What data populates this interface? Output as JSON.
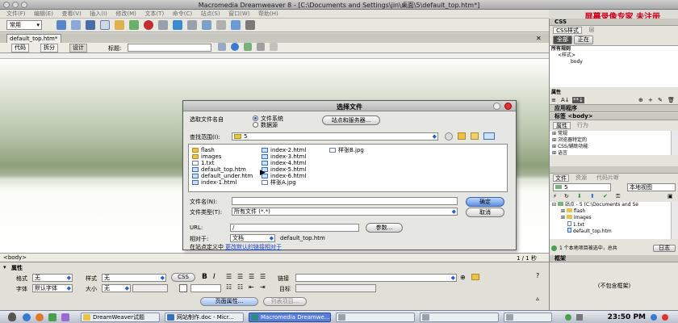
{
  "window": {
    "title": "Macromedia Dreamweaver 8 - [C:\\Documents and Settings\\jin\\桌面\\5\\default_top.htm*]"
  },
  "watermark": "屏幕录像专家 未注册",
  "menu": [
    "文件(F)",
    "编辑(E)",
    "查看(V)",
    "插入(I)",
    "修改(M)",
    "文本(T)",
    "命令(C)",
    "站点(S)",
    "窗口(W)",
    "帮助(H)"
  ],
  "insertbar": {
    "category": "常用"
  },
  "document": {
    "tab": "default_top.htm*",
    "views": {
      "code": "代码",
      "split": "拆分",
      "design": "设计"
    },
    "title_label": "标题:",
    "status_tag": "<body>",
    "status_right": "1 / 1 秒"
  },
  "properties": {
    "header": "属性",
    "format_label": "格式",
    "format_value": "无",
    "style_label": "样式",
    "style_value": "无",
    "css_button": "CSS",
    "font_label": "字体",
    "font_value": "默认字体",
    "size_label": "大小",
    "size_value": "无",
    "link_label": "链接",
    "target_label": "目标",
    "page_props_button": "页面属性...",
    "list_item_button": "列表项目..."
  },
  "right_panel": {
    "css_header": "CSS",
    "css_tabs": [
      "CSS样式",
      "层"
    ],
    "css_mode_all": "全部",
    "css_mode_current": "正在",
    "all_rules_label": "所有规则",
    "rules": [
      "<样式>",
      "body"
    ],
    "attributes_label": "属性",
    "app_header": "应用程序",
    "tag_header": "标签 <body>",
    "tag_tabs": [
      "属性",
      "行为"
    ],
    "tag_groups": [
      "常规",
      "浏览器特定的",
      "CSS/辅助功能",
      "语言"
    ],
    "files_header": "文件",
    "files_tabs": [
      "文件",
      "资源",
      "代码片断"
    ],
    "site_select": "5",
    "view_select": "本地视图",
    "tree": [
      "站点 - 5 (C:\\Documents and Se",
      "flash",
      "images",
      "1.txt",
      "default_top.htm"
    ],
    "files_status": "1 个本地项目被选中，总共",
    "files_log": "日志",
    "frames_header": "框架",
    "frames_empty": "(不包含框架)"
  },
  "dialog": {
    "title": "选择文件",
    "select_name_from": "选取文件名自",
    "opt_filesystem": "文件系统",
    "opt_datasource": "数据源",
    "sites_button": "站点和服务器...",
    "lookin_label": "查找范围(I):",
    "lookin_value": "5",
    "files": [
      {
        "name": "flash",
        "kind": "folder"
      },
      {
        "name": "images",
        "kind": "folder"
      },
      {
        "name": "1.txt",
        "kind": "doc"
      },
      {
        "name": "default_top.htm",
        "kind": "htm"
      },
      {
        "name": "default_under.htm",
        "kind": "htm"
      },
      {
        "name": "index-1.html",
        "kind": "htm"
      },
      {
        "name": "index-2.html",
        "kind": "htm"
      },
      {
        "name": "index-3.html",
        "kind": "htm"
      },
      {
        "name": "index-4.html",
        "kind": "htm"
      },
      {
        "name": "index-5.html",
        "kind": "htm"
      },
      {
        "name": "index-6.html",
        "kind": "htm"
      },
      {
        "name": "样张A.jpg",
        "kind": "doc"
      },
      {
        "name": "样张B.jpg",
        "kind": "doc"
      }
    ],
    "filename_label": "文件名(N):",
    "filename_value": "",
    "filetype_label": "文件类型(T):",
    "filetype_value": "所有文件 (*.*)",
    "ok_button": "确定",
    "cancel_button": "取消",
    "url_label": "URL:",
    "url_value": "/",
    "params_button": "参数...",
    "relative_label": "相对于:",
    "relative_value": "文档",
    "relative_file": "default_top.htm",
    "site_def_prefix": "在站点定义中",
    "site_def_link": "更改默认的链接相对于"
  },
  "taskbar": {
    "items": [
      "DreamWeaver试题",
      "网站制作.doc - Micr...",
      "Macromedia Dreamwe...",
      "",
      "",
      ""
    ],
    "clock": "23:50 PM"
  },
  "colors": {
    "accent": "#5a7ed6",
    "watermark": "#d0001c",
    "design_band": "#8ea07c"
  }
}
